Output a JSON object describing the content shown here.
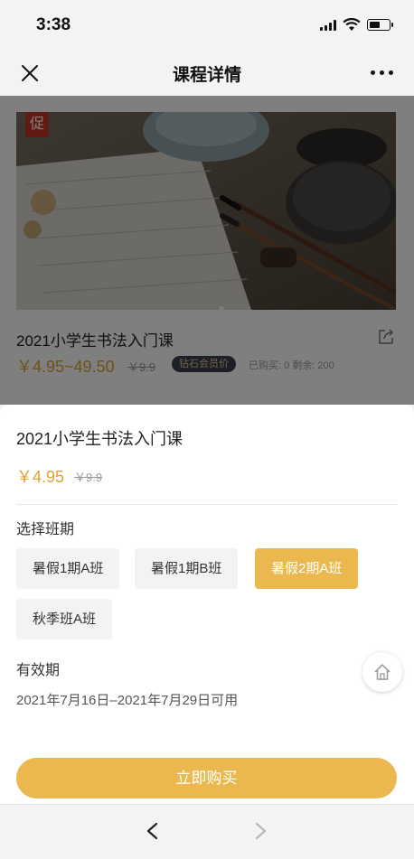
{
  "status_bar": {
    "time": "3:38",
    "battery_level": 0.6
  },
  "nav": {
    "title": "课程详情"
  },
  "course": {
    "promo_badge": "促",
    "title": "2021小学生书法入门课",
    "price_range": "￥4.95~49.50",
    "original_price": "￥9.9",
    "vip_label": "钻石会员价",
    "stats": "已购买: 0  剩余: 200"
  },
  "sheet": {
    "title": "2021小学生书法入门课",
    "price": "￥4.95",
    "original_price": "￥9.9",
    "class_label": "选择班期",
    "options": [
      {
        "label": "暑假1期A班",
        "selected": false
      },
      {
        "label": "暑假1期B班",
        "selected": false
      },
      {
        "label": "暑假2期A班",
        "selected": true
      },
      {
        "label": "秋季班A班",
        "selected": false
      }
    ],
    "validity_label": "有效期",
    "validity_value": "2021年7月16日–2021年7月29日可用",
    "buy_button": "立即购买"
  },
  "colors": {
    "accent": "#eab84f",
    "price": "#e0a032",
    "promo": "#c4342b"
  },
  "icons": [
    "close-icon",
    "more-icon",
    "share-icon",
    "home-icon",
    "back-arrow-icon",
    "forward-arrow-icon"
  ]
}
